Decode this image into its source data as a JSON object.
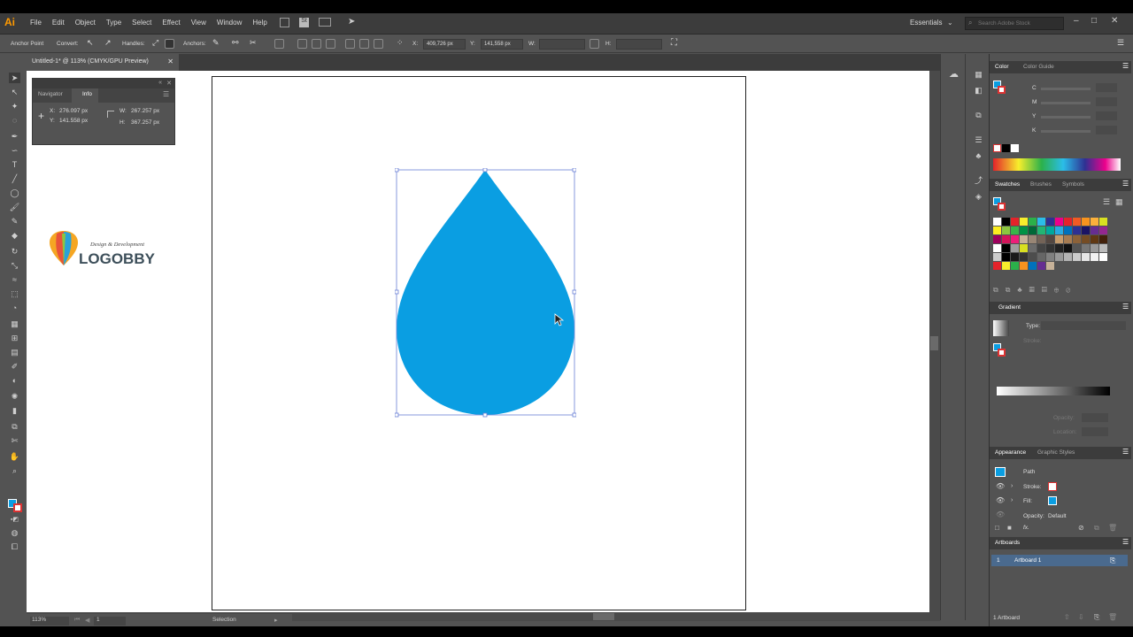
{
  "app": {
    "logo": "Ai"
  },
  "menu": [
    "File",
    "Edit",
    "Object",
    "Type",
    "Select",
    "Effect",
    "View",
    "Window",
    "Help"
  ],
  "workspace": "Essentials",
  "search_placeholder": "Search Adobe Stock",
  "control": {
    "anchor_point": "Anchor Point",
    "convert": "Convert:",
    "handles": "Handles:",
    "anchors": "Anchors:",
    "x_label": "X:",
    "x_value": "409,726 px",
    "y_label": "Y:",
    "y_value": "141,558 px",
    "w_label": "W:",
    "h_label": "H:"
  },
  "document_tab": "Untitled-1* @ 113% (CMYK/GPU Preview)",
  "info_panel": {
    "tabs": [
      "Navigator",
      "Info"
    ],
    "x_label": "X:",
    "x": "276.097 px",
    "y_label": "Y:",
    "y": "141.558 px",
    "w_label": "W:",
    "w": "267.257 px",
    "h_label": "H:",
    "h": "367.257 px"
  },
  "watermark": {
    "tagline": "Design & Development",
    "name": "LOGOBBY"
  },
  "droplet_color": "#0a9ee2",
  "color_panel": {
    "tabs": [
      "Color",
      "Color Guide"
    ],
    "channels": [
      "C",
      "M",
      "Y",
      "K"
    ]
  },
  "swatches_panel": {
    "tabs": [
      "Swatches",
      "Brushes",
      "Symbols"
    ]
  },
  "gradient_panel": {
    "title": "Gradient",
    "type_label": "Type:",
    "stroke_label": "Stroke:",
    "opacity_label": "Opacity:",
    "location_label": "Location:"
  },
  "appearance_panel": {
    "tabs": [
      "Appearance",
      "Graphic Styles"
    ],
    "object": "Path",
    "stroke_label": "Stroke:",
    "fill_label": "Fill:",
    "opacity_label": "Opacity:",
    "opacity_value": "Default",
    "fx_label": "fx."
  },
  "artboards_panel": {
    "title": "Artboards",
    "row_number": "1",
    "row_name": "Artboard 1",
    "footer": "1 Artboard"
  },
  "status": {
    "zoom": "113%",
    "artboard_number": "1",
    "tool": "Selection"
  }
}
